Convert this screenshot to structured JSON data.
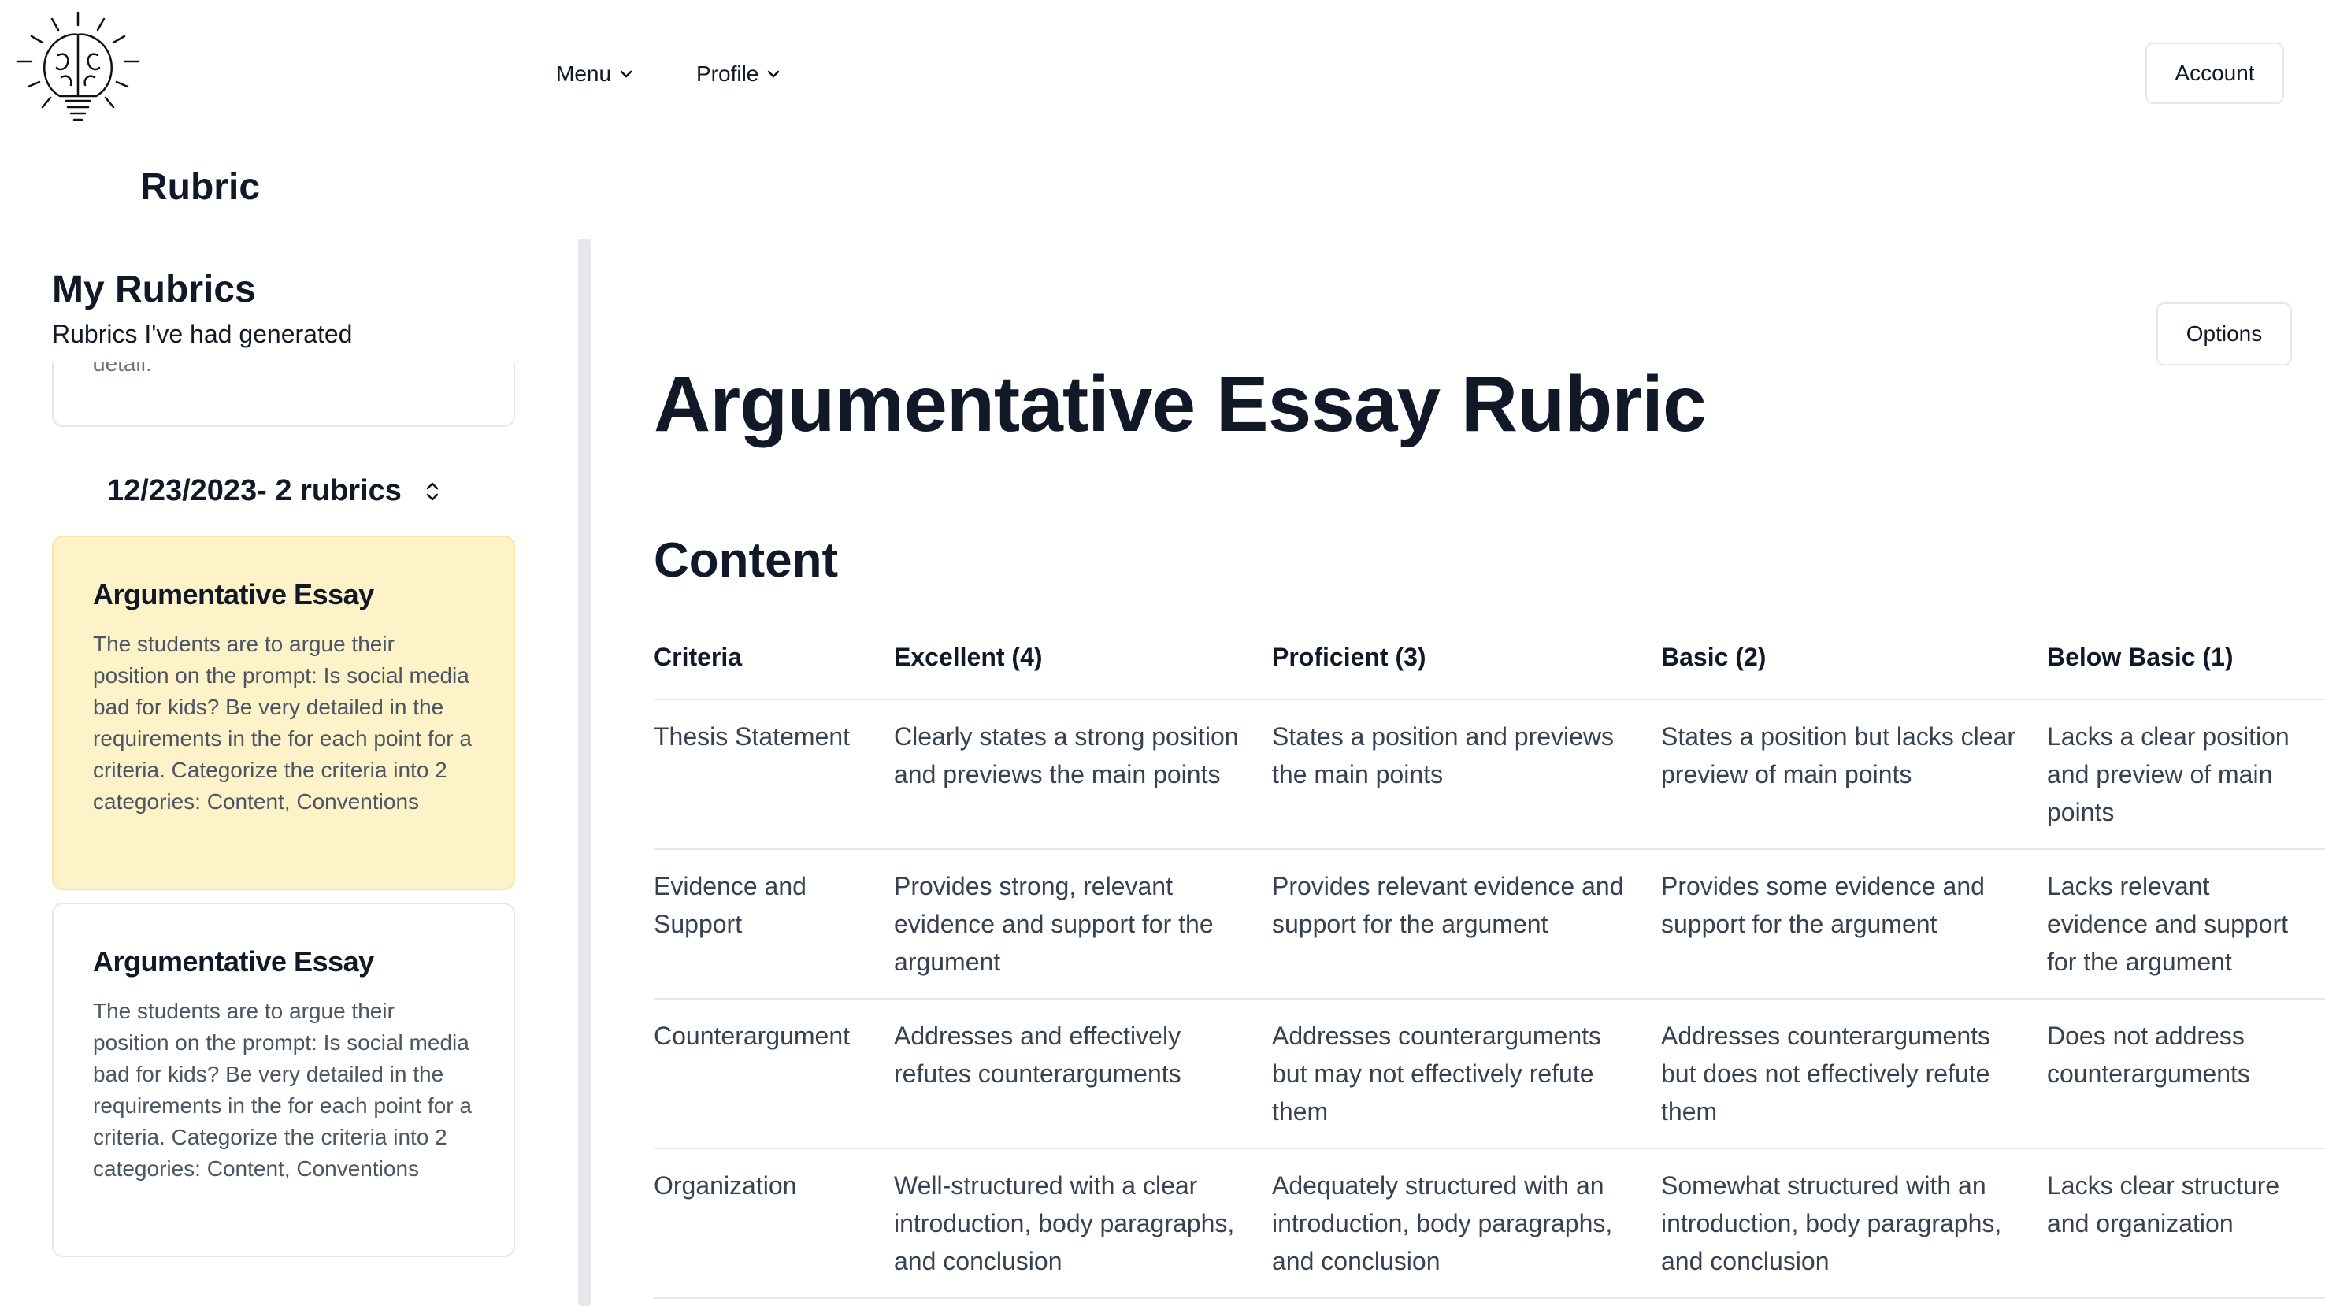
{
  "header": {
    "logo_icon": "brain-lightbulb-icon",
    "nav": [
      {
        "label": "Menu",
        "icon": "chevron-down-icon"
      },
      {
        "label": "Profile",
        "icon": "chevron-down-icon"
      }
    ],
    "account_label": "Account",
    "brand_title": "Rubric"
  },
  "sidebar": {
    "title": "My Rubrics",
    "subtitle": "Rubrics I've had generated",
    "clipped_card_text": "detail.",
    "group": {
      "label": "12/23/2023- 2 rubrics",
      "icon": "chevron-up-down-icon"
    },
    "cards": [
      {
        "title": "Argumentative Essay",
        "description": "The students are to argue their position on the prompt: Is social media bad for kids? Be very detailed in the requirements in the for each point for a criteria. Categorize the criteria into 2 categories: Content, Conventions",
        "state": "selected"
      },
      {
        "title": "Argumentative Essay",
        "description": "The students are to argue their position on the prompt: Is social media bad for kids? Be very detailed in the requirements in the for each point for a criteria. Categorize the criteria into 2 categories: Content, Conventions",
        "state": "default"
      }
    ]
  },
  "main": {
    "options_label": "Options",
    "title": "Argumentative Essay Rubric",
    "section_title": "Content",
    "table": {
      "headers": [
        "Criteria",
        "Excellent (4)",
        "Proficient (3)",
        "Basic (2)",
        "Below Basic (1)"
      ],
      "rows": [
        [
          "Thesis Statement",
          "Clearly states a strong position and previews the main points",
          "States a position and previews the main points",
          "States a position but lacks clear preview of main points",
          "Lacks a clear position and preview of main points"
        ],
        [
          "Evidence and Support",
          "Provides strong, relevant evidence and support for the argument",
          "Provides relevant evidence and support for the argument",
          "Provides some evidence and support for the argument",
          "Lacks relevant evidence and support for the argument"
        ],
        [
          "Counterargument",
          "Addresses and effectively refutes counterarguments",
          "Addresses counterarguments but may not effectively refute them",
          "Addresses counterarguments but does not effectively refute them",
          "Does not address counterarguments"
        ],
        [
          "Organization",
          "Well-structured with a clear introduction, body paragraphs, and conclusion",
          "Adequately structured with an introduction, body paragraphs, and conclusion",
          "Somewhat structured with an introduction, body paragraphs, and conclusion",
          "Lacks clear structure and organization"
        ]
      ]
    }
  },
  "colors": {
    "selected_card_bg": "#fdf2c8",
    "border": "#e5e7eb",
    "text_primary": "#111827",
    "text_muted": "#4b5563"
  }
}
